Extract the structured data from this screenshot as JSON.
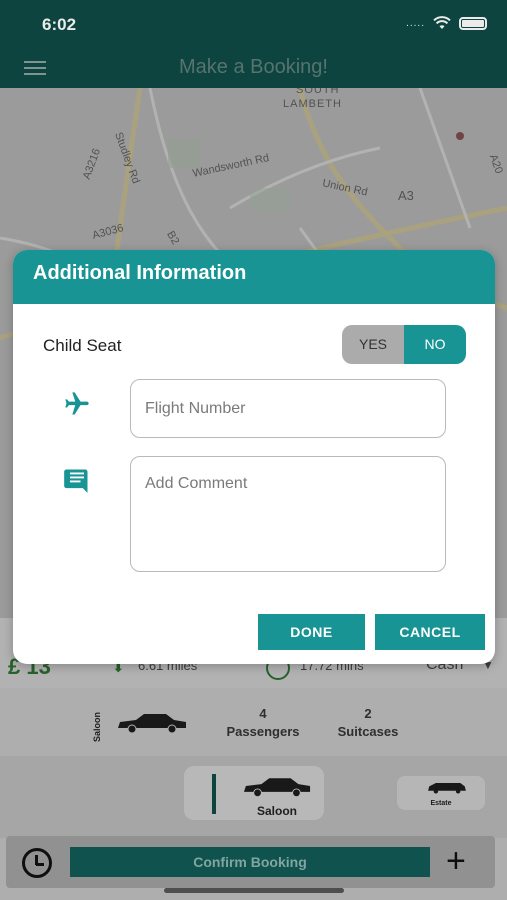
{
  "status_bar": {
    "time": "6:02",
    "signal": "....."
  },
  "header": {
    "title": "Make a Booking!"
  },
  "map": {
    "labels": [
      "SOUTH",
      "LAMBETH",
      "A3216",
      "Wandsworth Rd",
      "Union Rd",
      "A3",
      "A3036",
      "B2",
      "Studley Rd",
      "A20"
    ]
  },
  "booking": {
    "fare": "£ 13",
    "distance": "6.61 miles",
    "duration": "17.72 mins",
    "payment": "Cash",
    "car_type_vertical": "Saloon",
    "passengers_count": "4",
    "passengers_label": "Passengers",
    "suitcases_count": "2",
    "suitcases_label": "Suitcases",
    "vehicle_options": [
      "Saloon",
      "Estate"
    ],
    "confirm_label": "Confirm Booking"
  },
  "dialog": {
    "title": "Additional Information",
    "child_seat_label": "Child Seat",
    "toggle_yes": "YES",
    "toggle_no": "NO",
    "toggle_selected": "NO",
    "flight_placeholder": "Flight Number",
    "comment_placeholder": "Add Comment",
    "done_label": "DONE",
    "cancel_label": "CANCEL",
    "accent_color": "#199494"
  }
}
